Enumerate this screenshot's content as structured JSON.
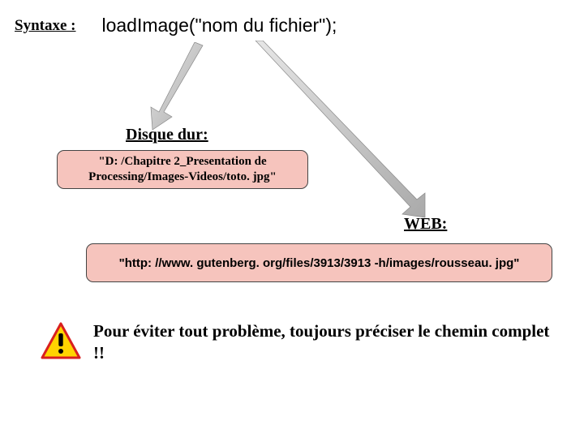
{
  "syntax": {
    "label": "Syntaxe :",
    "code": "loadImage(\"nom du fichier\");"
  },
  "sections": {
    "disque": {
      "label": "Disque dur:",
      "example": "\"D: /Chapitre 2_Presentation de Processing/Images-Videos/toto. jpg\""
    },
    "web": {
      "label": "WEB:",
      "example": "\"http: //www. gutenberg. org/files/3913/3913 -h/images/rousseau. jpg\""
    }
  },
  "warning": {
    "text": "Pour éviter tout problème, toujours préciser le chemin complet !!"
  },
  "colors": {
    "pink_box_bg": "#f6c4bd",
    "arrow_fill": "#c9c9c9",
    "warn_yellow": "#ffd400",
    "warn_red": "#d91f1f"
  }
}
